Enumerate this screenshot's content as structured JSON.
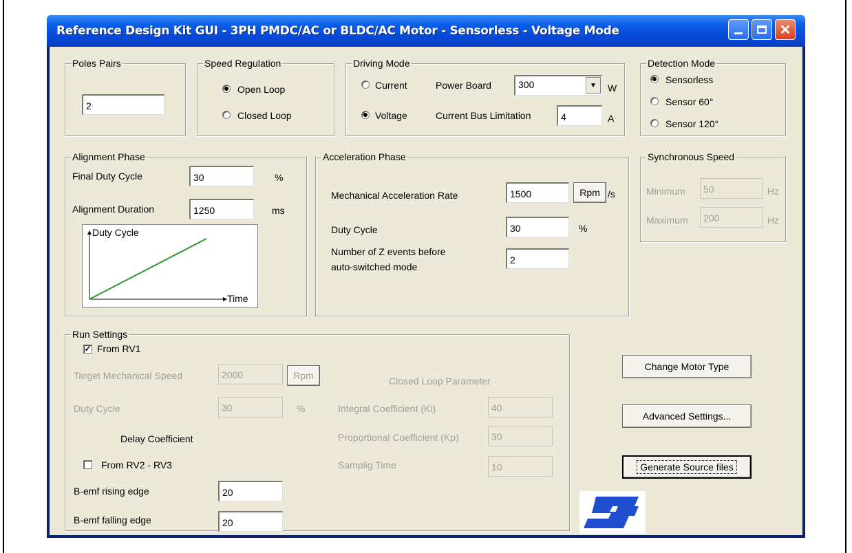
{
  "window": {
    "title": "Reference Design Kit GUI - 3PH PMDC/AC or BLDC/AC Motor - Sensorless - Voltage Mode"
  },
  "poles_pairs": {
    "title": "Poles Pairs",
    "value": "2"
  },
  "speed_regulation": {
    "title": "Speed Regulation",
    "options": [
      "Open Loop",
      "Closed Loop"
    ],
    "selected": "Open Loop"
  },
  "driving_mode": {
    "title": "Driving Mode",
    "current_label": "Current",
    "voltage_label": "Voltage",
    "selected": "Voltage",
    "power_board_label": "Power Board",
    "power_board_value": "300",
    "power_board_unit": "W",
    "current_bus_label": "Current Bus Limitation",
    "current_bus_value": "4",
    "current_bus_unit": "A"
  },
  "detection_mode": {
    "title": "Detection Mode",
    "options": [
      "Sensorless",
      "Sensor 60°",
      "Sensor 120°"
    ],
    "selected": "Sensorless"
  },
  "alignment_phase": {
    "title": "Alignment Phase",
    "final_duty_label": "Final Duty Cycle",
    "final_duty_value": "30",
    "final_duty_unit": "%",
    "duration_label": "Alignment Duration",
    "duration_value": "1250",
    "duration_unit": "ms",
    "plot_y_label": "Duty Cycle",
    "plot_x_label": "Time",
    "line_color": "#2a9a2a"
  },
  "acceleration_phase": {
    "title": "Acceleration Phase",
    "rate_label": "Mechanical Acceleration Rate",
    "rate_value": "1500",
    "rate_unit_button": "Rpm",
    "rate_unit_suffix": "/s",
    "duty_label": "Duty Cycle",
    "duty_value": "30",
    "duty_unit": "%",
    "z_events_label_1": "Number of Z events before",
    "z_events_label_2": "auto-switched mode",
    "z_events_value": "2"
  },
  "synchronous_speed": {
    "title": "Synchronous Speed",
    "min_label": "Minimum",
    "min_value": "50",
    "max_label": "Maximum",
    "max_value": "200",
    "unit": "Hz"
  },
  "run_settings": {
    "title": "Run Settings",
    "from_rv1_label": "From RV1",
    "from_rv1_checked": true,
    "target_speed_label": "Target Mechanical Speed",
    "target_speed_value": "2000",
    "target_speed_unit": "Rpm",
    "duty_label": "Duty Cycle",
    "duty_value": "30",
    "duty_unit": "%",
    "delay_coefficient_label": "Delay Coefficient",
    "from_rv2_rv3_label": "From RV2 - RV3",
    "from_rv2_rv3_checked": false,
    "bemf_rising_label": "B-emf rising edge",
    "bemf_rising_value": "20",
    "bemf_falling_label": "B-emf falling edge",
    "bemf_falling_value": "20",
    "closed_loop_title": "Closed Loop Parameter",
    "ki_label": "Integral Coefficient (Ki)",
    "ki_value": "40",
    "kp_label": "Proportional Coefficient (Kp)",
    "kp_value": "30",
    "sampling_label": "Samplig Time",
    "sampling_value": "10"
  },
  "buttons": {
    "change_motor": "Change Motor Type",
    "advanced": "Advanced Settings...",
    "generate": "Generate Source files"
  },
  "logo": {
    "text": "ST",
    "color": "#1f4fd0"
  }
}
